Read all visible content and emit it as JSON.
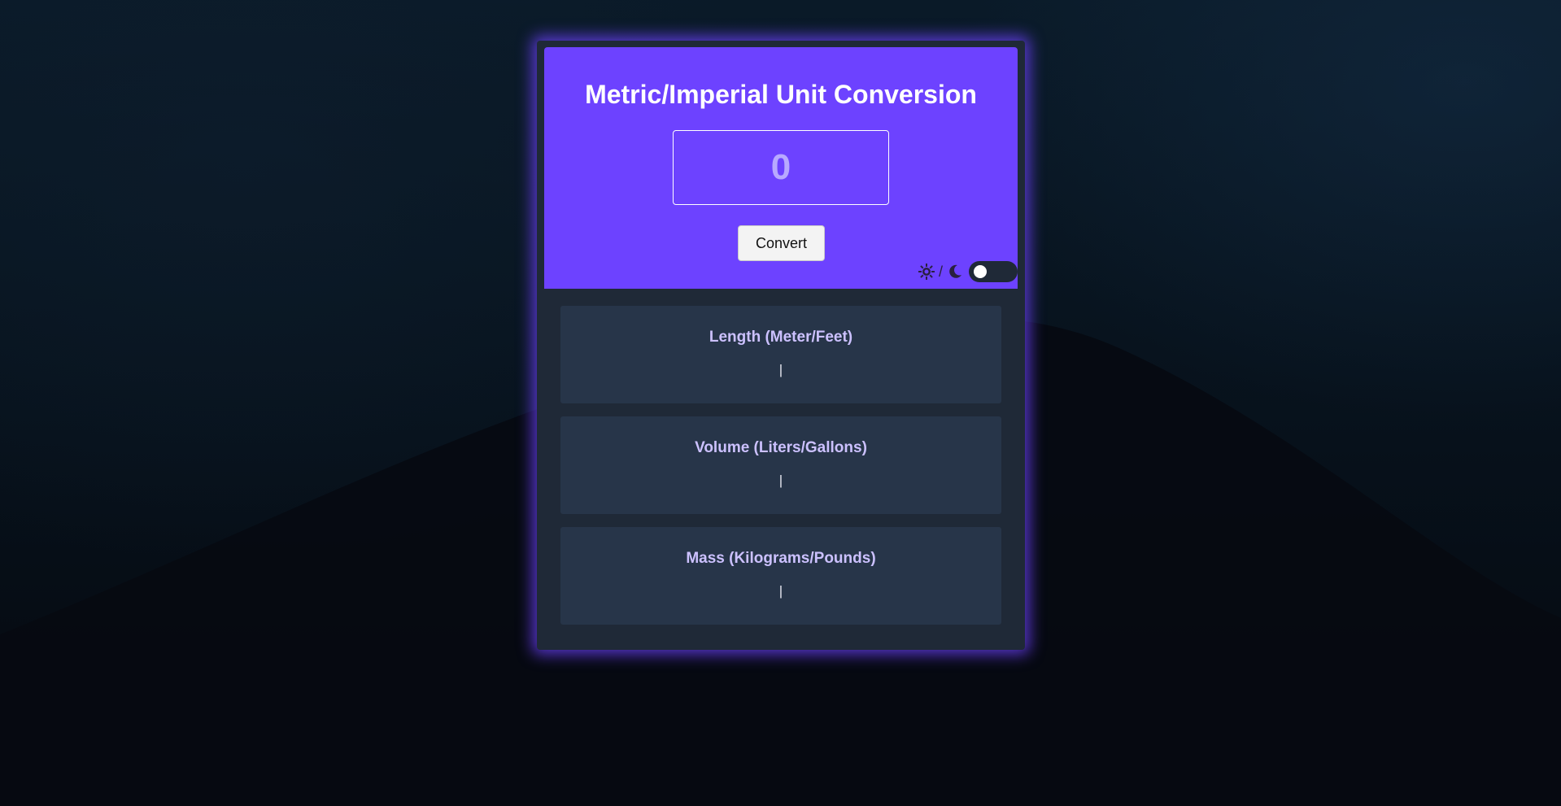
{
  "app": {
    "title": "Metric/Imperial Unit Conversion"
  },
  "input": {
    "value": "",
    "placeholder": "0"
  },
  "convert_button": {
    "label": "Convert"
  },
  "theme_switch": {
    "separator": "/",
    "light_icon": "sun-icon",
    "dark_icon": "moon-icon",
    "enabled": false
  },
  "results": [
    {
      "title": "Length (Meter/Feet)",
      "value": "|"
    },
    {
      "title": "Volume (Liters/Gallons)",
      "value": "|"
    },
    {
      "title": "Mass (Kilograms/Pounds)",
      "value": "|"
    }
  ],
  "colors": {
    "accent": "#6d42ff",
    "panel": "#1f2937",
    "result_box": "#273549",
    "result_title": "#ccc1ff"
  }
}
